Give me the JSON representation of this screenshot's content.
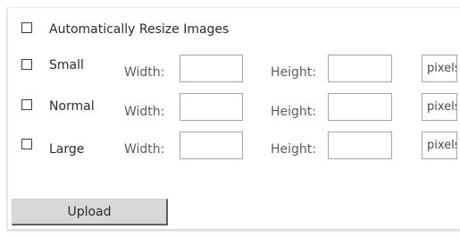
{
  "options": {
    "auto_resize_label": "Automatically Resize Images",
    "auto_resize_checked": false
  },
  "fields": {
    "width_label": "Width:",
    "height_label": "Height:"
  },
  "sizes": [
    {
      "label": "Small",
      "checked": false,
      "width_value": "",
      "height_value": "",
      "unit": "pixels"
    },
    {
      "label": "Normal",
      "checked": false,
      "width_value": "",
      "height_value": "",
      "unit": "pixels"
    },
    {
      "label": "Large",
      "checked": false,
      "width_value": "",
      "height_value": "",
      "unit": "pixels"
    }
  ],
  "actions": {
    "upload_label": "Upload"
  }
}
